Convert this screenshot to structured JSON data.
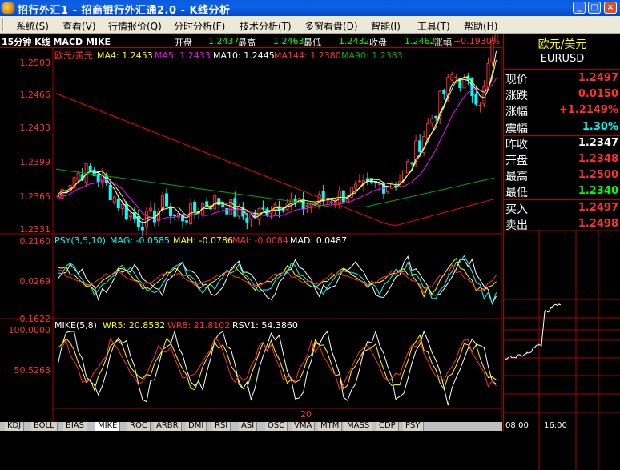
{
  "window": {
    "title": "招行外汇1 - 招商银行外汇通2.0 - K线分析",
    "buttons": {
      "minimize": "_",
      "maximize": "□",
      "close": "×"
    }
  },
  "menu": {
    "items": [
      {
        "label": "系统(S)"
      },
      {
        "label": "查看(V)"
      },
      {
        "label": "行情报价(Q)"
      },
      {
        "label": "分时分析(F)"
      },
      {
        "label": "技术分析(T)"
      },
      {
        "label": "多窗看盘(D)"
      },
      {
        "label": "智能(I)"
      },
      {
        "label": "工具(T)"
      },
      {
        "label": "帮助(H)"
      }
    ]
  },
  "chart_header": {
    "title": "15分钟 K线 MACD MIKE",
    "open_label": "开盘",
    "open": "1.2437",
    "high_label": "最高",
    "high": "1.2463",
    "low_label": "最低",
    "low": "1.2432",
    "close_label": "收盘",
    "close": "1.2462",
    "change_label": "涨幅",
    "change": "+0.1930%"
  },
  "main_panel": {
    "symbol_label": "欧元/美元",
    "ma_labels": [
      "MA4: 1.2453",
      "MA5: 1.2433",
      "MA10: 1.2445",
      "MA144: 1.2380",
      "MA90: 1.2383"
    ],
    "y_ticks": [
      "1.2500",
      "1.2466",
      "1.2433",
      "1.2399",
      "1.2365",
      "1.2331"
    ]
  },
  "psy_panel": {
    "labels": [
      "PSY(3,5,10)",
      "MAG: -0.0585",
      "MAH: -0.0786",
      "MAI: -0.0084",
      "MAD: 0.0487"
    ],
    "y_ticks": [
      "0.2160",
      "0.0269",
      "-0.1622"
    ]
  },
  "mike_panel": {
    "labels": [
      "MIKE(5,8)",
      "WR5: 20.8532",
      "WR8: 21.8102",
      "RSV1: 54.3860"
    ],
    "y_ticks": [
      "100.0000",
      "50.5263"
    ],
    "x_label": "20"
  },
  "quote": {
    "name": "欧元/美元",
    "code": "EURUSD",
    "rows": [
      {
        "label": "现价",
        "value": "1.2497",
        "color": "#ff3030"
      },
      {
        "label": "涨跌",
        "value": "0.0150",
        "color": "#ff3030"
      },
      {
        "label": "涨幅",
        "value": "+1.2149%",
        "color": "#ff3030"
      },
      {
        "label": "震幅",
        "value": "1.30%",
        "color": "#00ffff"
      },
      {
        "label": "昨收",
        "value": "1.2347",
        "color": "#ffffff"
      },
      {
        "label": "开盘",
        "value": "1.2348",
        "color": "#ff3030"
      },
      {
        "label": "最高",
        "value": "1.2500",
        "color": "#ff3030"
      },
      {
        "label": "最低",
        "value": "1.2340",
        "color": "#00ff00"
      },
      {
        "label": "买入",
        "value": "1.2497",
        "color": "#ff3030"
      },
      {
        "label": "卖出",
        "value": "1.2498",
        "color": "#ff3030"
      }
    ],
    "time_labels": [
      "08:00",
      "16:00"
    ]
  },
  "tabs": [
    "KDJ",
    "BOLL",
    "BIAS",
    "MIKE",
    "ROC",
    "ARBR",
    "DMI",
    "RSI",
    "ASI",
    "OSC",
    "VMA",
    "MTM",
    "MASS",
    "CDP",
    "PSY"
  ],
  "active_tab": "MIKE",
  "colors": {
    "up": "#ff3030",
    "down": "#00ffff",
    "ma4": "#ffffff",
    "ma5": "#ffff00",
    "ma10": "#ff00ff",
    "ma144": "#ff0000",
    "ma90": "#00aa00",
    "border": "#aa0000"
  }
}
